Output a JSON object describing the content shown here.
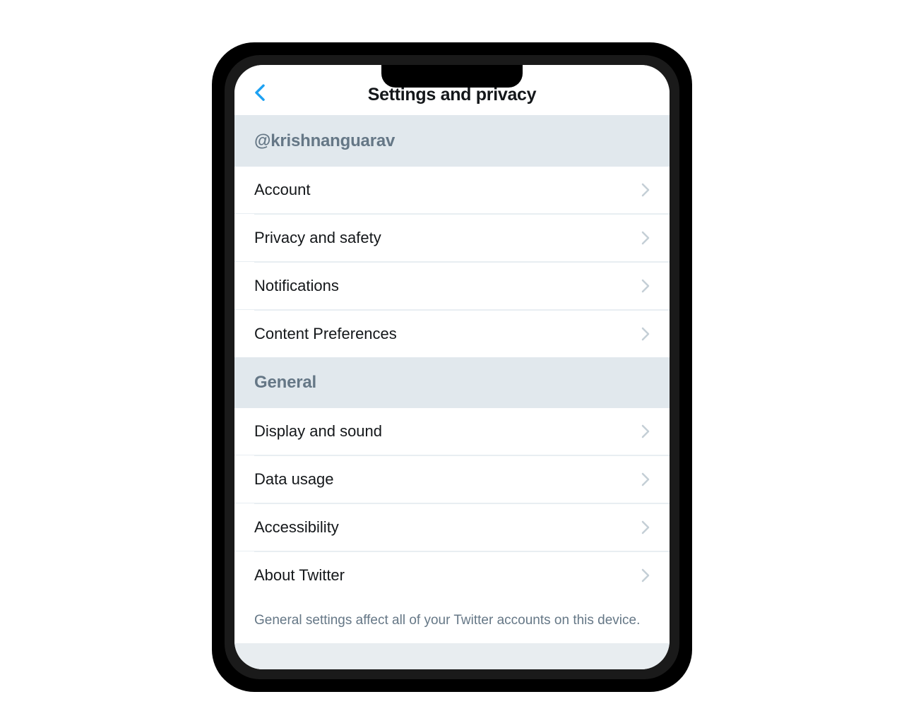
{
  "header": {
    "title": "Settings and privacy"
  },
  "sections": [
    {
      "header": "@krishnanguarav",
      "items": [
        {
          "label": "Account"
        },
        {
          "label": "Privacy and safety"
        },
        {
          "label": "Notifications"
        },
        {
          "label": "Content Preferences"
        }
      ]
    },
    {
      "header": "General",
      "items": [
        {
          "label": "Display and sound"
        },
        {
          "label": "Data usage"
        },
        {
          "label": "Accessibility"
        },
        {
          "label": "About Twitter"
        }
      ],
      "footer": "General settings affect all of your Twitter accounts on this device."
    }
  ]
}
